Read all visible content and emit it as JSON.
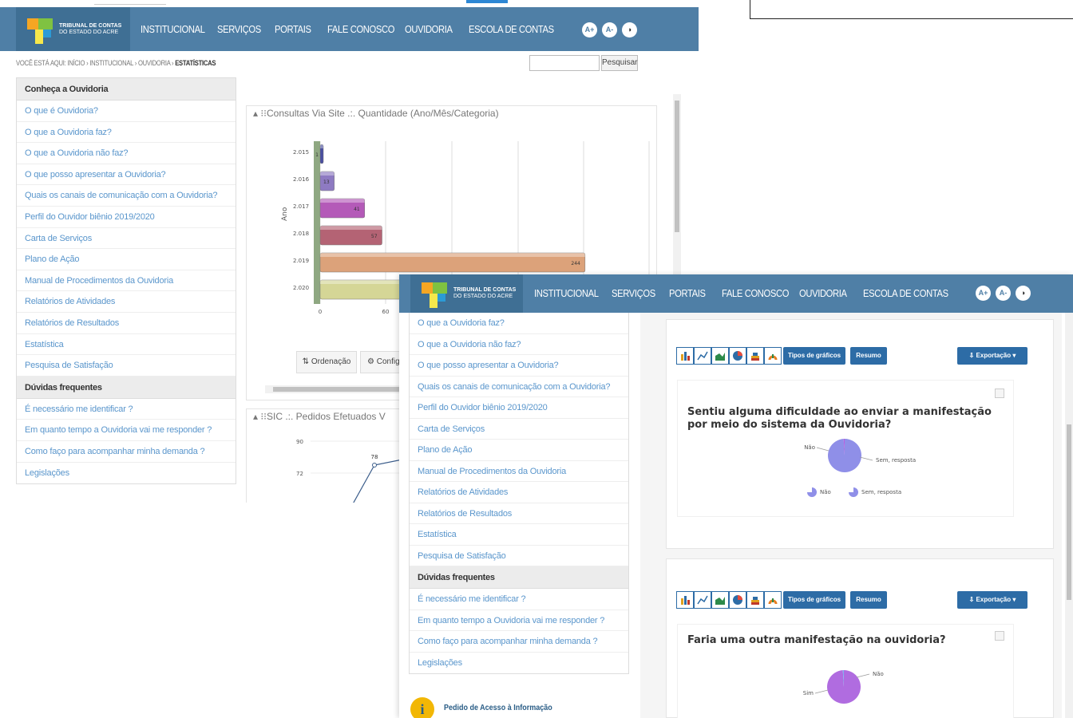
{
  "logo": {
    "line1": "TRIBUNAL DE CONTAS",
    "line2": "DO ESTADO DO ACRE"
  },
  "nav": [
    "INSTITUCIONAL",
    "SERVIÇOS",
    "PORTAIS",
    "FALE CONOSCO",
    "OUVIDORIA",
    "ESCOLA DE CONTAS"
  ],
  "accessibility": {
    "increase": "A+",
    "decrease": "A-",
    "contrast": "◑"
  },
  "breadcrumb": {
    "prefix": "VOCÊ ESTÁ AQUI:",
    "items": [
      "INÍCIO",
      "INSTITUCIONAL",
      "OUVIDORIA"
    ],
    "separator": "›",
    "current": "ESTATÍSTICAS"
  },
  "search": {
    "button": "Pesquisar",
    "placeholder": ""
  },
  "sidebar": {
    "section1_title": "Conheça a Ouvidoria",
    "section1_items": [
      "O que é Ouvidoria?",
      "O que a Ouvidoria faz?",
      "O que a Ouvidoria não faz?",
      "O que posso apresentar a Ouvidoria?",
      "Quais os canais de comunicação com a Ouvidoria?",
      "Perfil do Ouvidor biênio 2019/2020",
      "Carta de Serviços",
      "Plano de Ação",
      "Manual de Procedimentos da Ouvidoria",
      "Relatórios de Atividades",
      "Relatórios de Resultados",
      "Estatística",
      "Pesquisa de Satisfação"
    ],
    "section2_title": "Dúvidas frequentes",
    "section2_items": [
      "É necessário me identificar ?",
      "Em quanto tempo a Ouvidoria vai me responder ?",
      "Como faço para acompanhar minha demanda ?",
      "Legislações"
    ]
  },
  "back_panels": {
    "panel1_title": "Consultas Via Site .:. Quantidade (Ano/Mês/Categoria)",
    "panel2_title": "SIC .:. Pedidos Efetuados V",
    "ordenacao": "Ordenação",
    "config": "Config"
  },
  "chart_data": [
    {
      "type": "bar",
      "orientation": "horizontal",
      "ylabel": "Ano",
      "categories": [
        "2.015",
        "2.016",
        "2.017",
        "2.018",
        "2.019",
        "2.020"
      ],
      "values": [
        1,
        13,
        41,
        57,
        244,
        null
      ],
      "data_labels": [
        "1",
        "13",
        "41",
        "57",
        "244",
        ""
      ],
      "x_ticks": [
        "0",
        "60"
      ],
      "colors": [
        "#4a4fa0",
        "#8e7ac2",
        "#b45ab8",
        "#b46374",
        "#dca27a",
        "#d5d696"
      ]
    },
    {
      "type": "line",
      "y_ticks": [
        "90",
        "72"
      ],
      "data_labels": [
        "78"
      ]
    },
    {
      "type": "pie",
      "title": "Sentiu alguma dificuldade ao enviar a manifestação por meio do sistema da Ouvidoria?",
      "categories": [
        "Não",
        "Sem, resposta"
      ],
      "values": [
        99,
        1
      ],
      "colors": [
        "#8f8fe8",
        "#b85fe0"
      ]
    },
    {
      "type": "pie",
      "title": "Faria uma outra manifestação na ouvidoria?",
      "categories": [
        "Sim",
        "Não"
      ],
      "values": [
        99,
        1
      ],
      "colors": [
        "#b06ce0",
        "#7fb0f0"
      ]
    }
  ],
  "front_content": {
    "tipos": "Tipos de gráficos",
    "resumo": "Resumo",
    "exportacao": "Exportação",
    "pedido": "Pedido de Acesso à Informação"
  }
}
